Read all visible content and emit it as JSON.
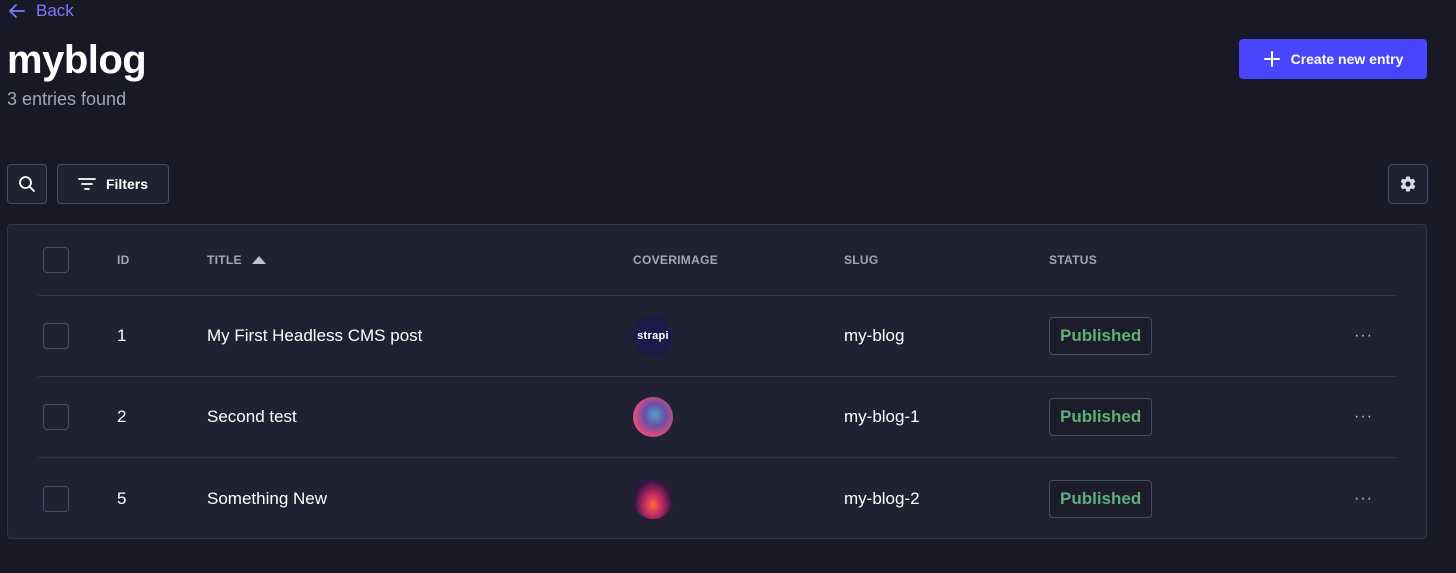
{
  "nav": {
    "back_label": "Back"
  },
  "header": {
    "title": "myblog",
    "subtitle": "3 entries found",
    "create_label": "Create new entry"
  },
  "toolbar": {
    "filters_label": "Filters"
  },
  "table": {
    "columns": [
      "ID",
      "TITLE",
      "COVERIMAGE",
      "SLUG",
      "STATUS"
    ],
    "sort": {
      "column": "TITLE",
      "direction": "ascending"
    },
    "rows": [
      {
        "id": "1",
        "title": "My First Headless CMS post",
        "cover_label": "strapi",
        "slug": "my-blog",
        "status": "Published"
      },
      {
        "id": "2",
        "title": "Second test",
        "cover_label": "",
        "slug": "my-blog-1",
        "status": "Published"
      },
      {
        "id": "5",
        "title": "Something New",
        "cover_label": "",
        "slug": "my-blog-2",
        "status": "Published"
      }
    ],
    "row_menu_label": "···"
  },
  "colors": {
    "background": "#181826",
    "surface": "#212134",
    "accent": "#4945ff",
    "link": "#7b79ff",
    "status_published": "#5cb176"
  },
  "icons": {
    "back": "arrow-left-icon",
    "create": "plus-icon",
    "search": "search-icon",
    "filters": "filter-icon",
    "settings": "gear-icon",
    "sort": "caret-up-icon",
    "row_menu": "more-dots-icon"
  }
}
